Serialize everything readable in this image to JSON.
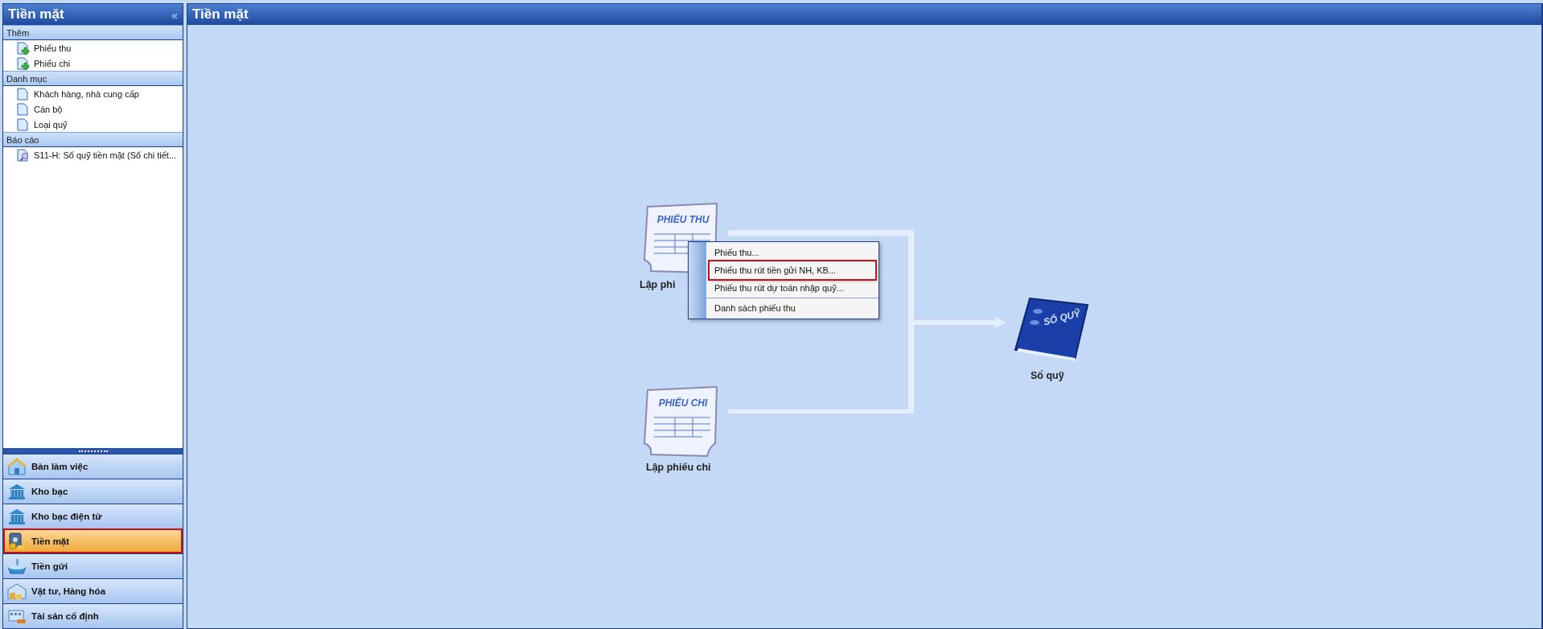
{
  "sidebar": {
    "title": "Tiền mặt",
    "collapse_glyph": "«",
    "sections": [
      {
        "title": "Thêm",
        "items": [
          {
            "label": "Phiếu thu",
            "kind": "add"
          },
          {
            "label": "Phiếu chi",
            "kind": "add"
          }
        ]
      },
      {
        "title": "Danh mục",
        "items": [
          {
            "label": "Khách hàng, nhà cung cấp",
            "kind": "doc"
          },
          {
            "label": "Cán bộ",
            "kind": "doc"
          },
          {
            "label": "Loại quỹ",
            "kind": "doc"
          }
        ]
      },
      {
        "title": "Báo cáo",
        "items": [
          {
            "label": "S11-H: Sổ quỹ tiền mặt (Sổ chi tiết...",
            "kind": "report"
          }
        ]
      }
    ]
  },
  "nav": [
    {
      "label": "Bàn làm việc",
      "kind": "house",
      "selected": false
    },
    {
      "label": "Kho bạc",
      "kind": "bank",
      "selected": false
    },
    {
      "label": "Kho bạc điện tử",
      "kind": "bank",
      "selected": false
    },
    {
      "label": "Tiền mặt",
      "kind": "safe",
      "selected": true
    },
    {
      "label": "Tiền gửi",
      "kind": "basin",
      "selected": false
    },
    {
      "label": "Vật tư, Hàng hóa",
      "kind": "store",
      "selected": false
    },
    {
      "label": "Tài sản cố định",
      "kind": "asset",
      "selected": false
    }
  ],
  "main": {
    "title": "Tiền mặt",
    "receipt": {
      "icon_text": "PHIẾU THU",
      "label": "Lập phi"
    },
    "payment": {
      "icon_text": "PHIẾU CHI",
      "label": "Lập phiếu chi"
    },
    "ledger": {
      "icon_text": "SỔ QUỸ",
      "label": "Sổ quỹ"
    },
    "context_menu": [
      {
        "label": "Phiếu thu...",
        "selected": false
      },
      {
        "label": "Phiếu thu rút tiền gửi NH, KB...",
        "selected": true
      },
      {
        "label": "Phiếu thu rút dự toán nhập quỹ...",
        "selected": false
      },
      {
        "label": "Danh sách phiếu thu",
        "selected": false
      }
    ]
  }
}
